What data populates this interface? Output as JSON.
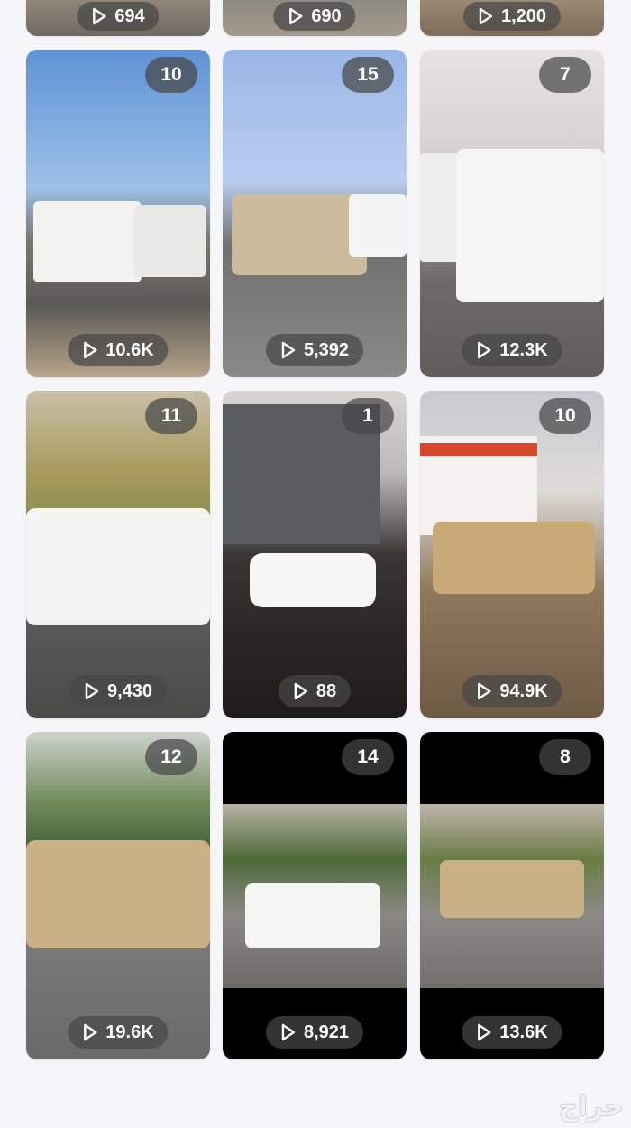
{
  "grid": {
    "tiles": [
      {
        "count": "",
        "views": "694"
      },
      {
        "count": "",
        "views": "690"
      },
      {
        "count": "",
        "views": "1,200"
      },
      {
        "count": "10",
        "views": "10.6K"
      },
      {
        "count": "15",
        "views": "5,392"
      },
      {
        "count": "7",
        "views": "12.3K"
      },
      {
        "count": "11",
        "views": "9,430"
      },
      {
        "count": "1",
        "views": "88"
      },
      {
        "count": "10",
        "views": "94.9K"
      },
      {
        "count": "12",
        "views": "19.6K"
      },
      {
        "count": "14",
        "views": "8,921"
      },
      {
        "count": "8",
        "views": "13.6K"
      }
    ]
  },
  "watermark": "حراج",
  "icons": {
    "views": "play-icon"
  }
}
